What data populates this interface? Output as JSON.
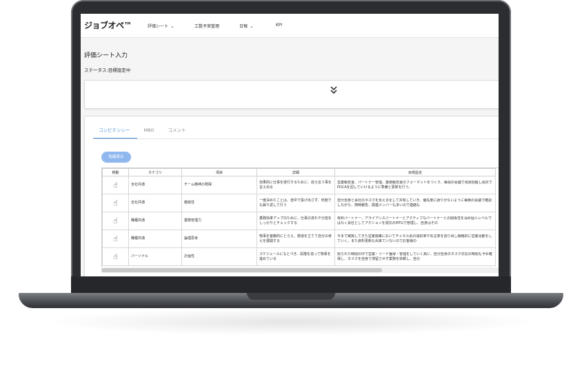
{
  "app": {
    "logo": "ジョブオペ™",
    "nav": [
      {
        "label": "評価シート",
        "has_dropdown": true
      },
      {
        "label": "工数予実管理",
        "has_dropdown": false
      },
      {
        "label": "日報",
        "has_dropdown": true
      },
      {
        "label": "KPI",
        "has_dropdown": false
      }
    ]
  },
  "page": {
    "title": "評価シート入力",
    "status": "ステータス:目標設定中",
    "expand_icon": "double-chevron-down-icon",
    "tabs": [
      {
        "label": "コンピテンシー",
        "active": true
      },
      {
        "label": "MBO",
        "active": false
      },
      {
        "label": "コメント",
        "active": false
      }
    ],
    "short_view_button": "短縮表示",
    "table": {
      "headers": [
        "移動",
        "カテゴリ",
        "項目",
        "詳細",
        "目標設定"
      ],
      "rows": [
        {
          "category": "全社共通",
          "item": "チーム精神の発揮",
          "detail": "効果的に仕事を遂行するために、自ら言う事を言え出る",
          "goal": "営業報告書、パートナー管理、業務報告書のフォーマットをつくり、毎週の会議で現状把握し週次でPDCAを回していけるように準備と更新を行う。"
        },
        {
          "category": "全社共通",
          "item": "徹底性",
          "detail": "一度決めたことは、途中で投げ出さず、何度でも繰り返して行う",
          "goal": "自分自身と会社のタスクを見える化して共有していき、優先度に誤りがないように毎朝の会議で確認しながら、随時報告、関連メンバーも多いので連絡も"
        },
        {
          "category": "職種共通",
          "item": "業務管理力",
          "detail": "業務効率アップのために、仕事の流れや分担をしっかりとチェックする",
          "goal": "有料パートナー、アライアンスパートナーとアクティブなパートナーとの関係性を深め個人レベルではなく会社としてアクションを週次のMTGで管理し、自身はその"
        },
        {
          "category": "職種共通",
          "item": "論理思考",
          "detail": "物事を客観的にとらえ、筋道を立てて自分の考えを展開する",
          "goal": "今まで実施してきた営業施策においてチャネル別の成約率や失注率を割り出し戦略的に営業活動をしていく。また資料更新も出来ていないのでお客様の"
        },
        {
          "category": "パーソナル",
          "item": "計画性",
          "detail": "スケジュールにもとづき、段階を追って物事を進めている",
          "goal": "限られた時間の中で営業・リード獲得・管理をしていく為に、自分自身のタスク対応の時間も予め確保し、タスクを自身で滞留させず業務を依頼し、自分"
        }
      ]
    }
  }
}
